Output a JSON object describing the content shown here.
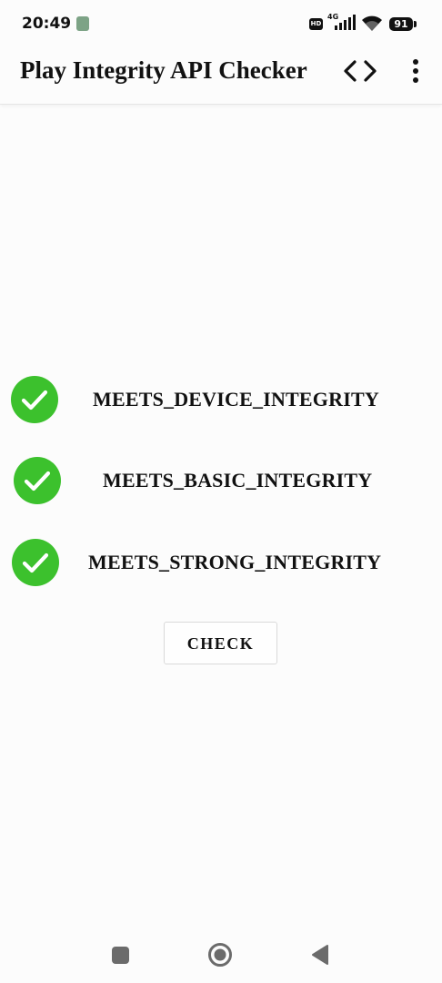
{
  "status_bar": {
    "time": "20:49",
    "hd_badge": "HD",
    "network": "4G",
    "battery": "91",
    "icons": [
      "notification-icon",
      "signal-icon",
      "wifi-icon",
      "battery-icon"
    ]
  },
  "app_bar": {
    "title": "Play Integrity API Checker",
    "icons": [
      "code-icon",
      "more-vert-icon"
    ]
  },
  "checks": [
    {
      "label": "MEETS_DEVICE_INTEGRITY",
      "passed": true
    },
    {
      "label": "MEETS_BASIC_INTEGRITY",
      "passed": true
    },
    {
      "label": "MEETS_STRONG_INTEGRITY",
      "passed": true
    }
  ],
  "check_button": {
    "label": "CHECK"
  },
  "nav_bar": {
    "icons": [
      "recents-icon",
      "home-icon",
      "back-icon"
    ]
  },
  "colors": {
    "success_green": "#3cc12d",
    "background": "#fcfcfc",
    "text": "#111111"
  }
}
